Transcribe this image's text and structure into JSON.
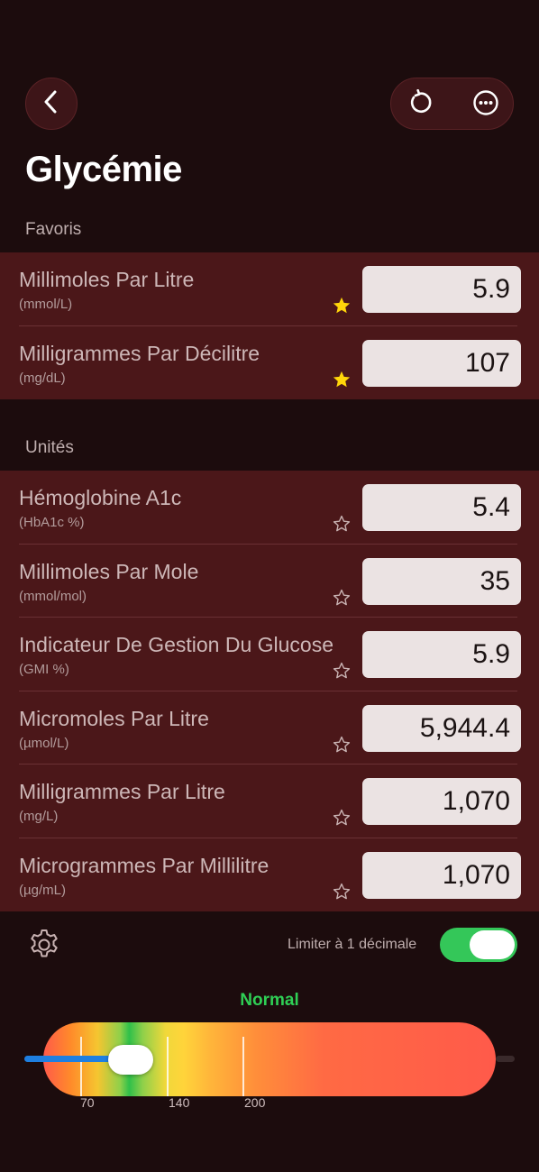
{
  "header": {
    "title": "Glycémie",
    "back_icon": "chevron-left-icon",
    "reset_icon": "reset-icon",
    "more_icon": "more-icon"
  },
  "favorites": {
    "label": "Favoris",
    "rows": [
      {
        "name": "Millimoles Par Litre",
        "unit": "(mmol/L)",
        "value": "5.9",
        "starred": true
      },
      {
        "name": "Milligrammes Par Décilitre",
        "unit": "(mg/dL)",
        "value": "107",
        "starred": true
      }
    ]
  },
  "units": {
    "label": "Unités",
    "rows": [
      {
        "name": "Hémoglobine A1c",
        "unit": "(HbA1c %)",
        "value": "5.4",
        "starred": false
      },
      {
        "name": "Millimoles Par Mole",
        "unit": "(mmol/mol)",
        "value": "35",
        "starred": false
      },
      {
        "name": "Indicateur De Gestion Du Glucose",
        "unit": "(GMI %)",
        "value": "5.9",
        "starred": false
      },
      {
        "name": "Micromoles Par Litre",
        "unit": "(µmol/L)",
        "value": "5,944.4",
        "starred": false
      },
      {
        "name": "Milligrammes Par Litre",
        "unit": "(mg/L)",
        "value": "1,070",
        "starred": false
      },
      {
        "name": "Microgrammes Par Millilitre",
        "unit": "(µg/mL)",
        "value": "1,070",
        "starred": false
      }
    ]
  },
  "settings": {
    "gear_icon": "gear-icon",
    "limit_label": "Limiter à 1 décimale",
    "limit_enabled": true
  },
  "gauge": {
    "status": "Normal",
    "status_color": "#2fcf55",
    "ticks": [
      "70",
      "140",
      "200"
    ],
    "slider_value": 107
  },
  "colors": {
    "background": "#1c0c0d",
    "section": "#4b1719",
    "star_filled": "#ffd60a",
    "toggle_on": "#34c759",
    "slider_fill": "#1e7fe0"
  }
}
